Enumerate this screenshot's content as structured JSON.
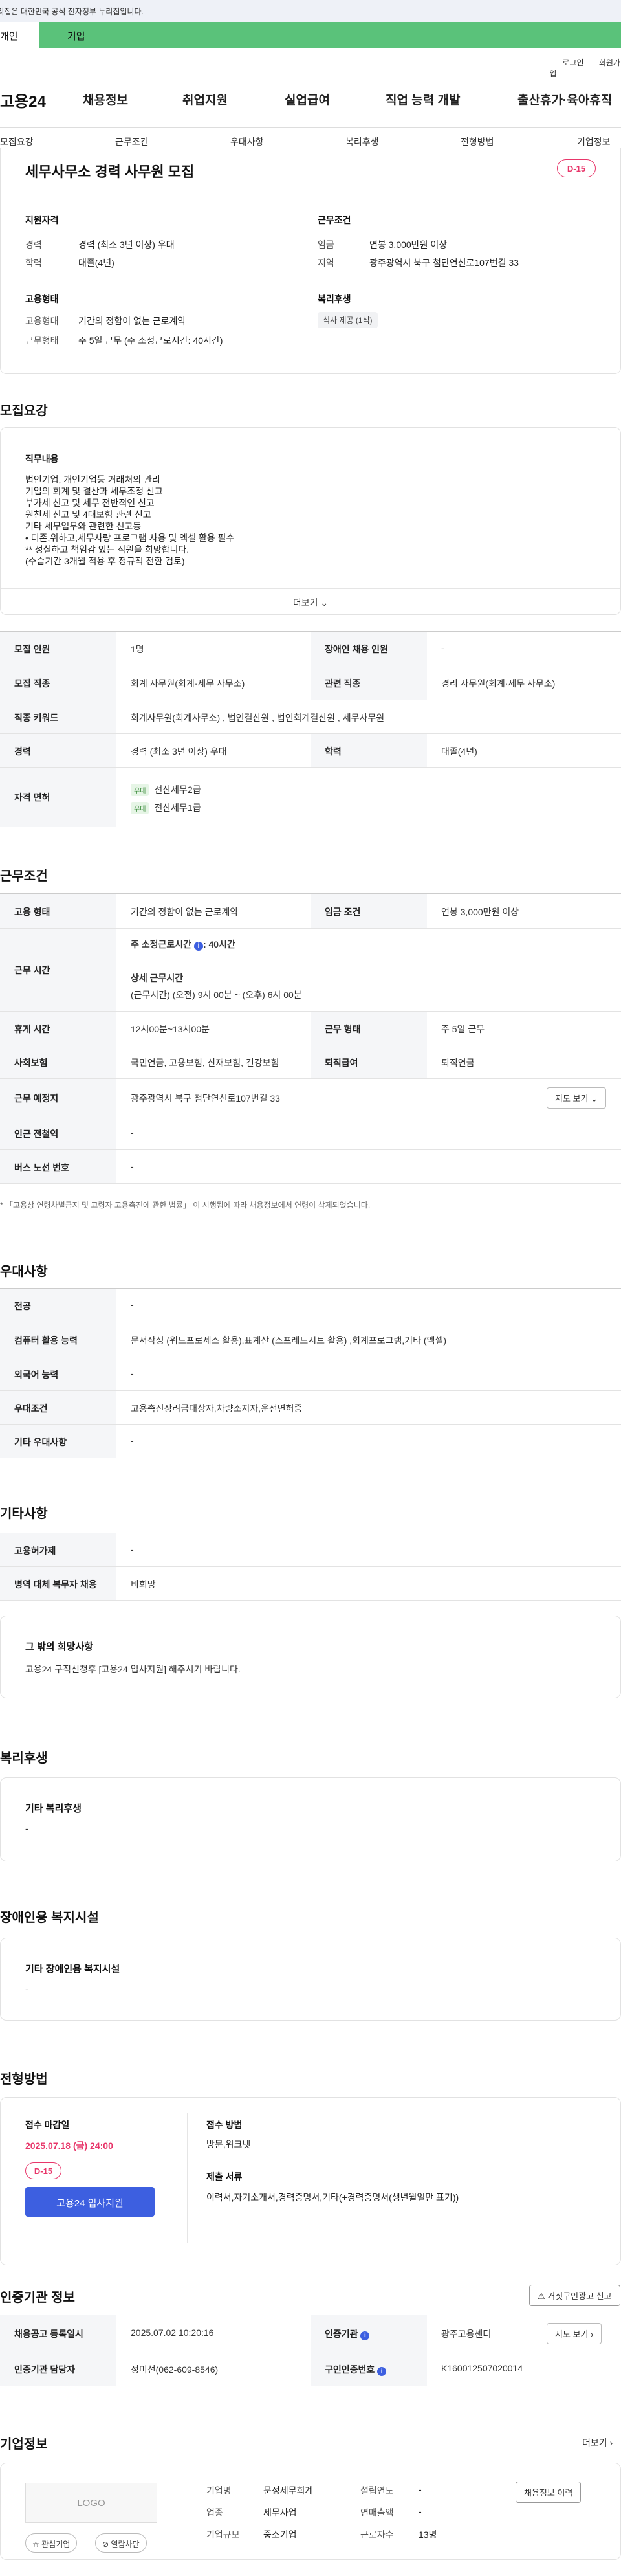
{
  "gov_banner": "이 누리집은 대한민국 공식 전자정부 누리집입니다.",
  "tabs": {
    "personal": "개인",
    "company": "기업"
  },
  "util": {
    "login": "로그인",
    "join": "회원가입"
  },
  "logo": "고용24",
  "gnb": [
    "채용정보",
    "취업지원",
    "실업급여",
    "직업 능력 개발",
    "출산휴가·육아휴직"
  ],
  "subnav": [
    "모집요강",
    "근무조건",
    "우대사항",
    "복리후생",
    "전형방법",
    "기업정보"
  ],
  "summary": {
    "title": "세무사무소 경력 사무원 모집",
    "dday": "D-15",
    "qualification_head": "지원자격",
    "career_label": "경력",
    "career_value": "경력 (최소 3년 이상) 우대",
    "edu_label": "학력",
    "edu_value": "대졸(4년)",
    "condition_head": "근무조건",
    "wage_label": "임금",
    "wage_value": "연봉 3,000만원 이상",
    "region_label": "지역",
    "region_value": "광주광역시 북구 첨단연신로107번길 33",
    "employment_head": "고용형태",
    "emp_type_label": "고용형태",
    "emp_type_value": "기간의 정함이 없는 근로계약",
    "work_type_label": "근무형태",
    "work_type_value": "주 5일 근무 (주 소정근로시간: 40시간)",
    "welfare_head": "복리후생",
    "welfare_tag": "식사 제공 (1식)"
  },
  "recruit": {
    "section_title": "모집요강",
    "duty_head": "직무내용",
    "duty_lines": [
      "법인기업, 개인기업등 거래처의 관리",
      "기업의 회계 및 결산과 세무조정 신고",
      "부가세 신고 및 세무 전반적인 신고",
      "원천세 신고 및 4대보험 관련 신고",
      "기타 세무업무와 관련한 신고등",
      "• 더존,위하고,세무사랑 프로그램 사용 및 엑셀 활용 필수",
      "** 성실하고 책임감 있는 직원을 희망합니다.",
      "(수습기간 3개월 적용 후 정규직 전환 검토)"
    ],
    "more": "더보기",
    "table": [
      {
        "h1": "모집 인원",
        "v1": "1명",
        "h2": "장애인 채용 인원",
        "v2": "-"
      },
      {
        "h1": "모집 직종",
        "v1": "회계 사무원(회계·세무 사무소)",
        "h2": "관련 직종",
        "v2": "경리 사무원(회계·세무 사무소)"
      },
      {
        "h1": "직종 키워드",
        "v1": "회계사무원(회계사무소) , 법인결산원 , 법인회계결산원 , 세무사무원"
      },
      {
        "h1": "경력",
        "v1": "경력 (최소 3년 이상) 우대",
        "h2": "학력",
        "v2": "대졸(4년)"
      }
    ],
    "license_head": "자격 면허",
    "license_badge": "우대",
    "licenses": [
      "전산세무2급",
      "전산세무1급"
    ]
  },
  "work": {
    "section_title": "근무조건",
    "emp_type_head": "고용 형태",
    "emp_type": "기간의 정함이 없는 근로계약",
    "wage_head": "임금 조건",
    "wage": "연봉 3,000만원 이상",
    "hours_head": "근무 시간",
    "hours_main": "주 소정근로시간",
    "hours_main_value": ": 40시간",
    "hours_detail_head": "상세 근무시간",
    "hours_detail": "(근무시간) (오전) 9시 00분 ~ (오후) 6시 00분",
    "break_head": "휴게 시간",
    "break_value": "12시00분~13시00분",
    "form_head": "근무 형태",
    "form_value": "주 5일 근무",
    "insurance_head": "사회보험",
    "insurance_value": "국민연금, 고용보험, 산재보험, 건강보험",
    "retire_head": "퇴직급여",
    "retire_value": "퇴직연금",
    "location_head": "근무 예정지",
    "location_value": "광주광역시 북구 첨단연신로107번길 33",
    "map_btn": "지도 보기",
    "subway_head": "인근 전철역",
    "subway_value": "-",
    "bus_head": "버스 노선 번호",
    "bus_value": "-",
    "note": "* 「고용상 연령차별금지 및 고령자 고용촉진에 관한 법률」 이 시행됨에 따라 채용정보에서 연령이 삭제되었습니다."
  },
  "prefer": {
    "section_title": "우대사항",
    "rows": [
      {
        "h": "전공",
        "v": "-"
      },
      {
        "h": "컴퓨터 활용 능력",
        "v": "문서작성 (워드프로세스 활용),표계산 (스프레드시트 활용) ,회계프로그램,기타 (엑셀)"
      },
      {
        "h": "외국어 능력",
        "v": "-"
      },
      {
        "h": "우대조건",
        "v": "고용촉진장려금대상자,차량소지자,운전면허증"
      },
      {
        "h": "기타 우대사항",
        "v": "-"
      }
    ]
  },
  "etc": {
    "section_title": "기타사항",
    "rows": [
      {
        "h": "고용허가제",
        "v": "-"
      },
      {
        "h": "병역 대체 복무자 채용",
        "v": "비희망"
      }
    ],
    "wish_head": "그 밖의 희망사항",
    "wish_text": "고용24 구직신청후 [고용24 입사지원] 해주시기 바랍니다."
  },
  "welfare": {
    "section_title": "복리후생",
    "head": "기타 복리후생",
    "value": "-"
  },
  "disability": {
    "section_title": "장애인용 복지시설",
    "head": "기타 장애인용 복지시설",
    "value": "-"
  },
  "selection": {
    "section_title": "전형방법",
    "deadline_head": "접수 마감일",
    "deadline": "2025.07.18 (금) 24:00",
    "dday": "D-15",
    "apply_btn": "고용24 입사지원",
    "method_head": "접수 방법",
    "method_value": "방문,워크넷",
    "docs_head": "제출 서류",
    "docs_value": "이력서,자기소개서,경력증명서,기타(+경력증명서(생년월일만 표기))"
  },
  "cert": {
    "section_title": "인증기관 정보",
    "report_btn": "거짓구인광고 신고",
    "reg_date_head": "채용공고 등록일시",
    "reg_date": "2025.07.02 10:20:16",
    "agency_head": "인증기관",
    "agency": "광주고용센터",
    "map_btn": "지도 보기",
    "manager_head": "인증기관 담당자",
    "manager": "정미선(062-609-8546)",
    "cert_no_head": "구인인증번호",
    "cert_no": "K160012507020014"
  },
  "company": {
    "section_title": "기업정보",
    "more": "더보기",
    "logo": "LOGO",
    "fav_btn": "관심기업",
    "block_btn": "열람차단",
    "name_head": "기업명",
    "name": "문정세무회계",
    "industry_head": "업종",
    "industry": "세무사업",
    "size_head": "기업규모",
    "size": "중소기업",
    "year_head": "설립연도",
    "year": "-",
    "revenue_head": "연매출액",
    "revenue": "-",
    "staff_head": "근로자수",
    "staff": "13명",
    "history_btn": "채용정보 이력"
  },
  "colors": {
    "accent_green": "#5ac27a",
    "dday_pink": "#e8366a",
    "apply_blue": "#3d5fe0"
  }
}
